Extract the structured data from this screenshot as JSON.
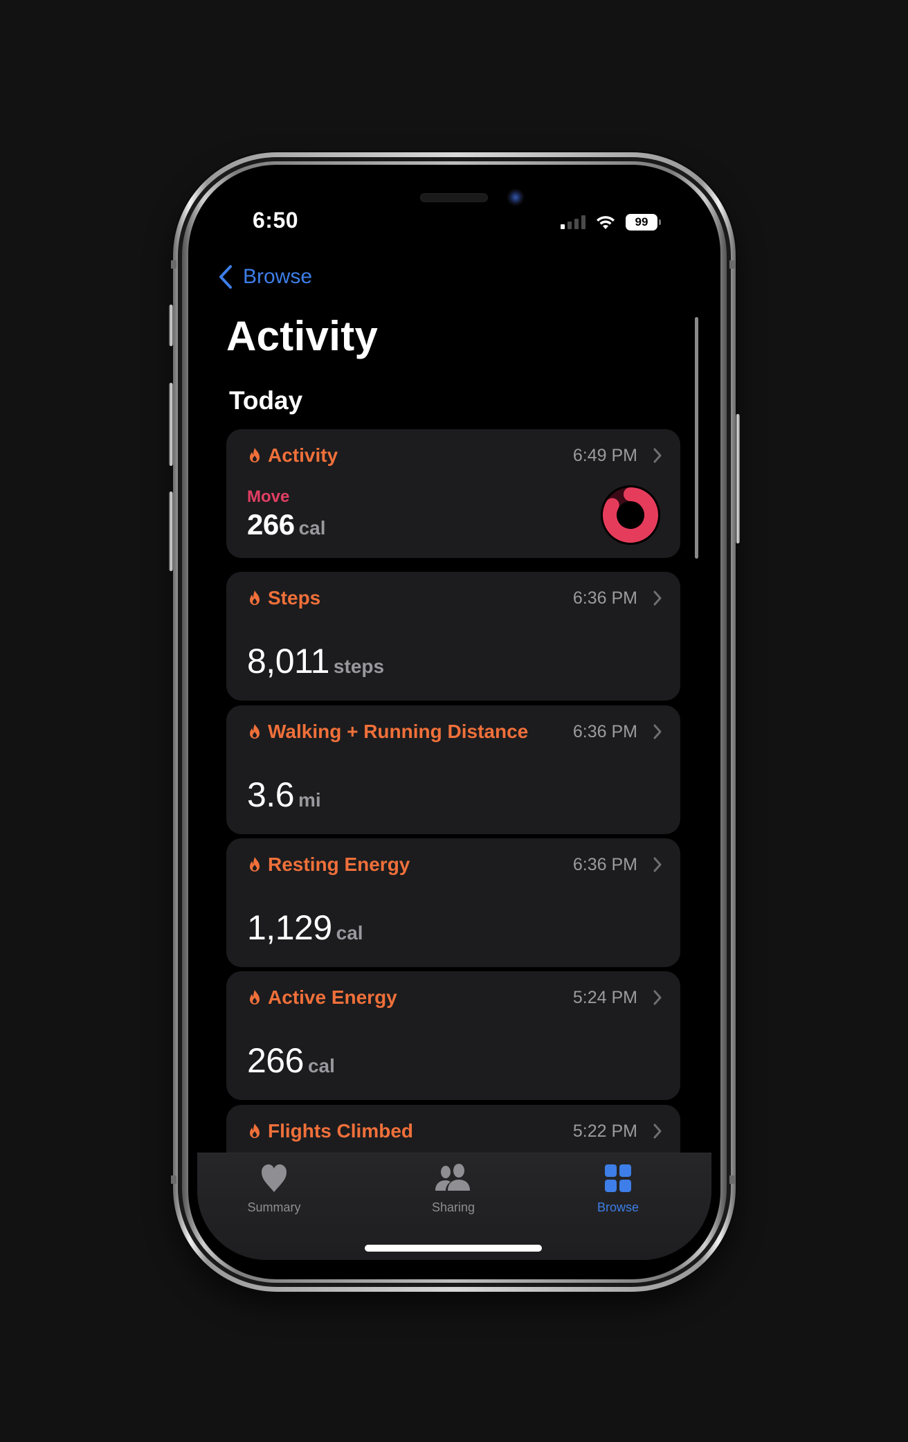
{
  "status_bar": {
    "time": "6:50",
    "signal_bars_active": 1,
    "signal_bars_total": 4,
    "wifi_icon": "wifi-icon",
    "battery_level": "99"
  },
  "nav": {
    "back_label": "Browse",
    "back_icon": "chevron-left-icon"
  },
  "page": {
    "title": "Activity",
    "section_title": "Today"
  },
  "colors": {
    "accent_blue": "#3d7ee8",
    "category_orange": "#f0703a",
    "move_red": "#e23f63",
    "card_bg": "#1c1c1e"
  },
  "cards": [
    {
      "title": "Activity",
      "icon": "flame-icon",
      "time": "6:49 PM",
      "sub_label": "Move",
      "value": "266",
      "unit": "cal",
      "ring_progress": 0.83
    },
    {
      "title": "Steps",
      "icon": "flame-icon",
      "time": "6:36 PM",
      "value": "8,011",
      "unit": "steps"
    },
    {
      "title": "Walking + Running Distance",
      "icon": "flame-icon",
      "time": "6:36 PM",
      "value": "3.6",
      "unit": "mi"
    },
    {
      "title": "Resting Energy",
      "icon": "flame-icon",
      "time": "6:36 PM",
      "value": "1,129",
      "unit": "cal"
    },
    {
      "title": "Active Energy",
      "icon": "flame-icon",
      "time": "5:24 PM",
      "value": "266",
      "unit": "cal"
    },
    {
      "title": "Flights Climbed",
      "icon": "flame-icon",
      "time": "5:22 PM"
    }
  ],
  "tab_bar": {
    "tabs": [
      {
        "label": "Summary",
        "icon": "heart-icon",
        "active": false
      },
      {
        "label": "Sharing",
        "icon": "people-icon",
        "active": false
      },
      {
        "label": "Browse",
        "icon": "grid-icon",
        "active": true
      }
    ]
  }
}
